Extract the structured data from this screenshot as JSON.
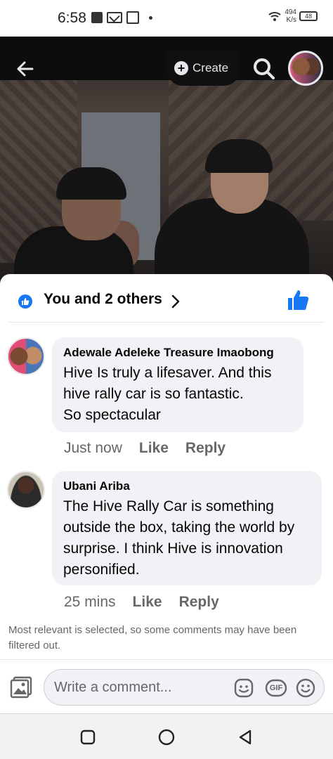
{
  "status_bar": {
    "time": "6:58",
    "speed_value": "494",
    "speed_unit": "K/s",
    "battery": "48"
  },
  "header": {
    "create_label": "Create"
  },
  "reactions": {
    "summary": "You and 2 others"
  },
  "comments": [
    {
      "author": "Adewale Adeleke Treasure Imaobong",
      "text": "Hive Is truly a lifesaver. And this hive rally car is so fantastic.\nSo spectacular",
      "time": "Just now",
      "like_label": "Like",
      "reply_label": "Reply"
    },
    {
      "author": "Ubani Ariba",
      "text": "The Hive Rally Car is something outside the box, taking the world by surprise. I think Hive is innovation personified.",
      "time": "25 mins",
      "like_label": "Like",
      "reply_label": "Reply"
    }
  ],
  "filter_note": "Most relevant is selected, so some comments may have been filtered out.",
  "composer": {
    "placeholder": "Write a comment...",
    "gif_label": "GIF"
  },
  "colors": {
    "accent": "#1877f2",
    "secondary_text": "#65676b",
    "bubble": "#f0f2f5"
  },
  "icons": [
    "back-arrow-icon",
    "plus-circle-icon",
    "search-icon",
    "thumbs-up-icon",
    "chevron-right-icon",
    "photo-icon",
    "sticker-icon",
    "gif-icon",
    "emoji-icon"
  ]
}
